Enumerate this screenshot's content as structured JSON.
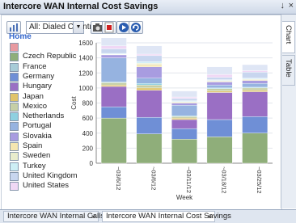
{
  "window": {
    "title": "Intercore WAN Internal Cost Savings",
    "pin_icon": "pin-icon",
    "close_icon": "close-icon"
  },
  "toolbar": {
    "chart_type_icon": "bar-chart-icon",
    "filter_value": "All: Dialed Country",
    "camera_icon": "camera-icon",
    "export_icon": "pdf-export-icon",
    "play_icon": "play-icon",
    "refresh_icon": "refresh-icon"
  },
  "breadcrumb": {
    "home": "Home"
  },
  "legend": [
    {
      "label": "",
      "color": "#e89aa0"
    },
    {
      "label": "Czech Republic",
      "color": "#8fae7a"
    },
    {
      "label": "France",
      "color": "#a8ccd8"
    },
    {
      "label": "Germany",
      "color": "#6f8fd6"
    },
    {
      "label": "Hungary",
      "color": "#9a6fc4"
    },
    {
      "label": "Japan",
      "color": "#e0c46a"
    },
    {
      "label": "Mexico",
      "color": "#c6cfa6"
    },
    {
      "label": "Netherlands",
      "color": "#8fd0e0"
    },
    {
      "label": "Portugal",
      "color": "#96b3e0"
    },
    {
      "label": "Slovakia",
      "color": "#a89ce0"
    },
    {
      "label": "Spain",
      "color": "#f5e6b0"
    },
    {
      "label": "Sweden",
      "color": "#e8eccc"
    },
    {
      "label": "Turkey",
      "color": "#cdeef5"
    },
    {
      "label": "United Kingdom",
      "color": "#c8d6ef"
    },
    {
      "label": "United States",
      "color": "#f0d8f5"
    }
  ],
  "side_tabs": {
    "chart": "Chart",
    "table": "Table"
  },
  "bottom_tabs": [
    {
      "label": "Intercore WAN Internal Calls",
      "close": "×"
    },
    {
      "label": "Intercore WAN Internal Cost Savings",
      "close": "×"
    }
  ],
  "chart_data": {
    "type": "bar",
    "stacked": true,
    "xlabel": "Week",
    "ylabel": "Cost",
    "ylim": [
      0,
      1600
    ],
    "yticks": [
      0,
      200,
      400,
      600,
      800,
      1000,
      1200,
      1400,
      1600
    ],
    "categories": [
      "~03/6/12",
      "~03/6/12",
      "~03/11/12",
      "~03/18/12",
      "~03/25/12"
    ],
    "series": [
      {
        "name": "Czech Republic",
        "color": "#8fae7a",
        "values": [
          600,
          390,
          320,
          350,
          400
        ]
      },
      {
        "name": "Germany",
        "color": "#6f8fd6",
        "values": [
          150,
          220,
          140,
          230,
          220
        ]
      },
      {
        "name": "Hungary",
        "color": "#9a6fc4",
        "values": [
          270,
          360,
          120,
          360,
          330
        ]
      },
      {
        "name": "Japan",
        "color": "#e0c46a",
        "values": [
          20,
          30,
          20,
          20,
          20
        ]
      },
      {
        "name": "Mexico",
        "color": "#c6cfa6",
        "values": [
          30,
          40,
          20,
          30,
          30
        ]
      },
      {
        "name": "Netherlands",
        "color": "#8fd0e0",
        "values": [
          10,
          20,
          10,
          10,
          10
        ]
      },
      {
        "name": "Portugal",
        "color": "#96b3e0",
        "values": [
          320,
          70,
          140,
          40,
          50
        ]
      },
      {
        "name": "Slovakia",
        "color": "#a89ce0",
        "values": [
          40,
          150,
          30,
          40,
          40
        ]
      },
      {
        "name": "Spain",
        "color": "#f5e6b0",
        "values": [
          5,
          30,
          10,
          10,
          10
        ]
      },
      {
        "name": "Sweden",
        "color": "#e8eccc",
        "values": [
          5,
          20,
          10,
          10,
          10
        ]
      },
      {
        "name": "Turkey",
        "color": "#cdeef5",
        "values": [
          10,
          20,
          10,
          10,
          10
        ]
      },
      {
        "name": "United Kingdom",
        "color": "#c8d6ef",
        "values": [
          60,
          80,
          30,
          30,
          80
        ]
      },
      {
        "name": "United States",
        "color": "#f0d8f5",
        "values": [
          40,
          20,
          20,
          40,
          20
        ]
      },
      {
        "name": "United States",
        "color": "#dfe6f5",
        "values": [
          110,
          110,
          80,
          100,
          80
        ]
      }
    ]
  }
}
